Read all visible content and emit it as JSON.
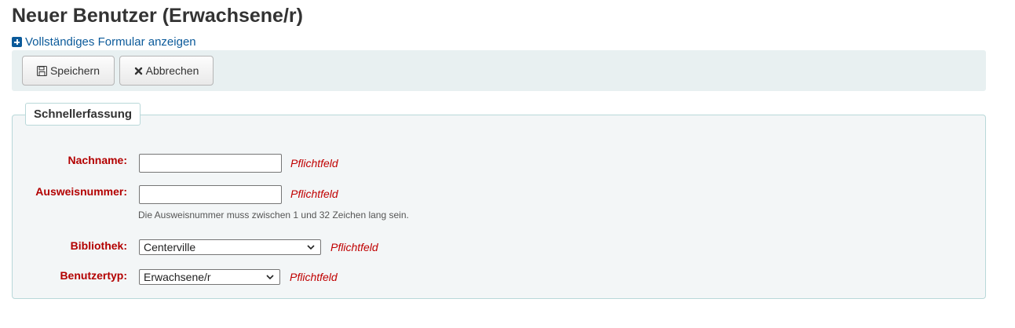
{
  "page": {
    "title": "Neuer Benutzer (Erwachsene/r)",
    "full_form_link": "Vollständiges Formular anzeigen"
  },
  "toolbar": {
    "save_label": "Speichern",
    "cancel_label": "Abbrechen"
  },
  "form": {
    "legend": "Schnellerfassung",
    "fields": {
      "surname": {
        "label": "Nachname:",
        "value": "",
        "required_text": "Pflichtfeld"
      },
      "cardnumber": {
        "label": "Ausweisnummer:",
        "value": "",
        "required_text": "Pflichtfeld",
        "hint": "Die Ausweisnummer muss zwischen 1 und 32 Zeichen lang sein."
      },
      "library": {
        "label": "Bibliothek:",
        "selected": "Centerville",
        "required_text": "Pflichtfeld"
      },
      "category": {
        "label": "Benutzertyp:",
        "selected": "Erwachsene/r",
        "required_text": "Pflichtfeld"
      }
    }
  },
  "colors": {
    "required": "#b30000",
    "link": "#0b5a9a",
    "toolbar_bg": "#e8f0f1",
    "fieldset_border": "#b9d8d9"
  },
  "icons": {
    "toggle": "plus-square-icon",
    "save": "floppy-disk-icon",
    "cancel": "x-icon",
    "select": "chevron-down-icon"
  }
}
